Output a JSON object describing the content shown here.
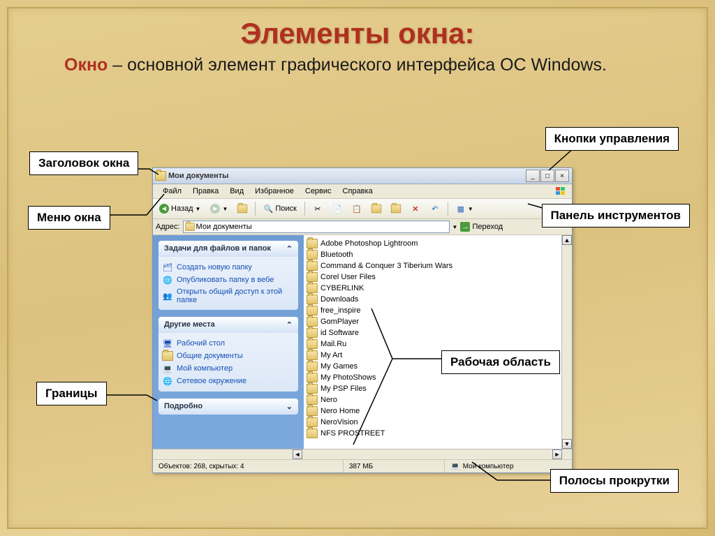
{
  "slide": {
    "title": "Элементы окна:",
    "paragraph_em": "Окно",
    "paragraph_rest": " – основной элемент графического интерфейса ОС Windows."
  },
  "callouts": {
    "header": "Заголовок окна",
    "menu": "Меню окна",
    "controls": "Кнопки управления",
    "toolbar": "Панель инструментов",
    "borders": "Границы",
    "workarea": "Рабочая область",
    "scrollbars": "Полосы прокрутки"
  },
  "window": {
    "title": "Мои документы",
    "menu": [
      "Файл",
      "Правка",
      "Вид",
      "Избранное",
      "Сервис",
      "Справка"
    ],
    "toolbar": {
      "back": "Назад",
      "search": "Поиск"
    },
    "address": {
      "label": "Адрес:",
      "value": "Мои документы",
      "go": "Переход"
    },
    "sidebar": {
      "tasks": {
        "header": "Задачи для файлов и папок",
        "items": [
          "Создать новую папку",
          "Опубликовать папку в вебе",
          "Открыть общий доступ к этой папке"
        ]
      },
      "places": {
        "header": "Другие места",
        "items": [
          "Рабочий стол",
          "Общие документы",
          "Мой компьютер",
          "Сетевое окружение"
        ]
      },
      "details": {
        "header": "Подробно"
      }
    },
    "files": [
      "Adobe Photoshop Lightroom",
      "Bluetooth",
      "Command & Conquer 3 Tiberium Wars",
      "Corel User Files",
      "CYBERLINK",
      "Downloads",
      "free_inspire",
      "GomPlayer",
      "id Software",
      "Mail.Ru",
      "My Art",
      "My Games",
      "My PhotoShows",
      "My PSP Files",
      "Nero",
      "Nero Home",
      "NeroVision",
      "NFS PROSTREET"
    ],
    "status": {
      "objects": "Объектов: 268, скрытых: 4",
      "size": "387 МБ",
      "location": "Мой компьютер"
    }
  }
}
